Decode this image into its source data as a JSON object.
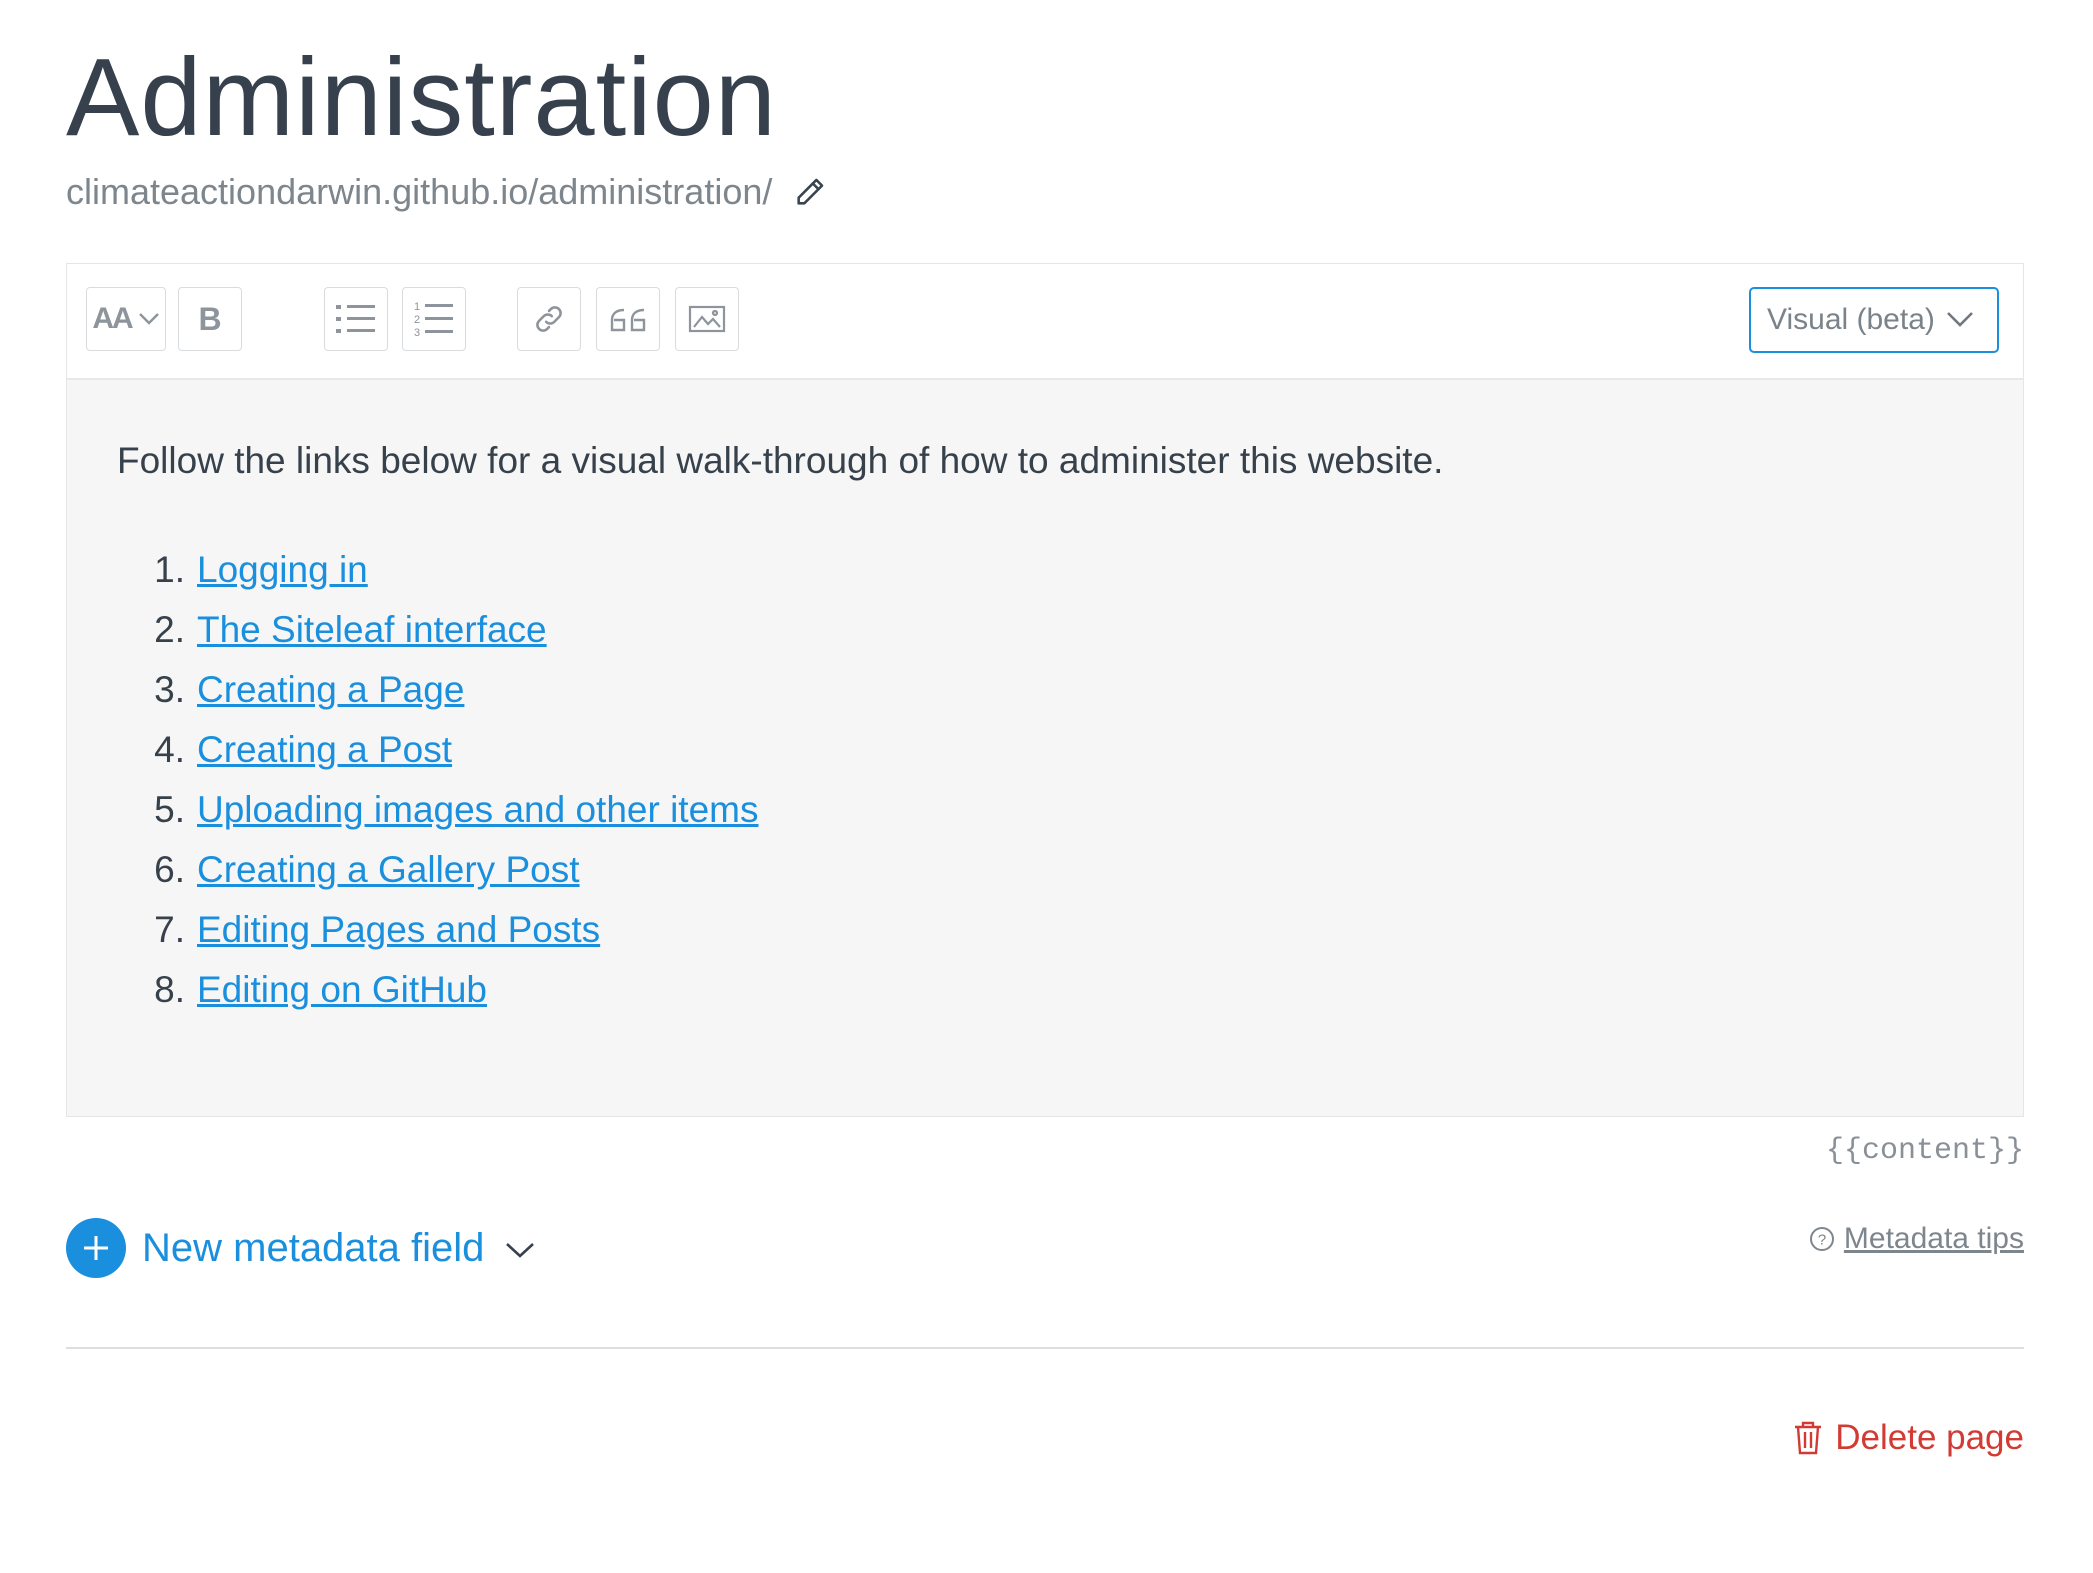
{
  "page": {
    "title": "Administration",
    "permalink": "climateactiondarwin.github.io/administration/"
  },
  "toolbar": {
    "heading_label": "AA",
    "bold_label": "B",
    "mode_select": "Visual (beta)"
  },
  "content": {
    "intro": "Follow the links below for a visual walk-through of how to administer this website.",
    "links": [
      {
        "num": "1.",
        "label": "Logging in"
      },
      {
        "num": "2.",
        "label": "The Siteleaf interface"
      },
      {
        "num": "3.",
        "label": "Creating a Page"
      },
      {
        "num": "4.",
        "label": "Creating a Post"
      },
      {
        "num": "5.",
        "label": "Uploading images and other items"
      },
      {
        "num": "6.",
        "label": "Creating a Gallery Post"
      },
      {
        "num": "7.",
        "label": "Editing Pages and Posts"
      },
      {
        "num": "8.",
        "label": "Editing on GitHub"
      }
    ],
    "tag": "{{content}}"
  },
  "metadata": {
    "new_field_label": "New metadata field",
    "tips_label": "Metadata tips"
  },
  "actions": {
    "delete_label": "Delete page"
  },
  "colors": {
    "accent": "#1a8fde",
    "danger": "#d23b34",
    "editor_bg": "#f6f6f6"
  }
}
